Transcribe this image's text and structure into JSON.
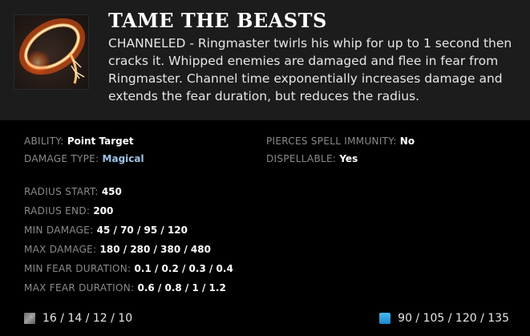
{
  "ability": {
    "title": "TAME THE BEASTS",
    "icon": "ringmaster-whip-icon",
    "description": "CHANNELED - Ringmaster twirls his whip for up to 1 second then cracks it. Whipped enemies are damaged and flee in fear from Ringmaster. Channel time exponentially increases damage and extends the fear duration, but reduces the radius."
  },
  "properties": {
    "ability_label": "ABILITY:",
    "ability_value": "Point Target",
    "damage_type_label": "DAMAGE TYPE:",
    "damage_type_value": "Magical",
    "pierces_label": "PIERCES SPELL IMMUNITY:",
    "pierces_value": "No",
    "dispellable_label": "DISPELLABLE:",
    "dispellable_value": "Yes"
  },
  "stats": [
    {
      "label": "RADIUS START:",
      "value": "450"
    },
    {
      "label": "RADIUS END:",
      "value": "200"
    },
    {
      "label": "MIN DAMAGE:",
      "value": "45 / 70 / 95 / 120"
    },
    {
      "label": "MAX DAMAGE:",
      "value": "180 / 280 / 380 / 480"
    },
    {
      "label": "MIN FEAR DURATION:",
      "value": "0.1 / 0.2 / 0.3 / 0.4"
    },
    {
      "label": "MAX FEAR DURATION:",
      "value": "0.6 / 0.8 / 1 / 1.2"
    }
  ],
  "footer": {
    "cooldown_icon": "cooldown-icon",
    "cooldown": "16 / 14 / 12 / 10",
    "mana_icon": "mana-cost-icon",
    "mana_cost": "90 / 105 / 120 / 135"
  },
  "colors": {
    "header_bg": "#1c1c1c",
    "body_bg": "#000000",
    "label": "#8a8a8a",
    "magical": "#9ec3e6",
    "mana": "#2a9be0"
  }
}
